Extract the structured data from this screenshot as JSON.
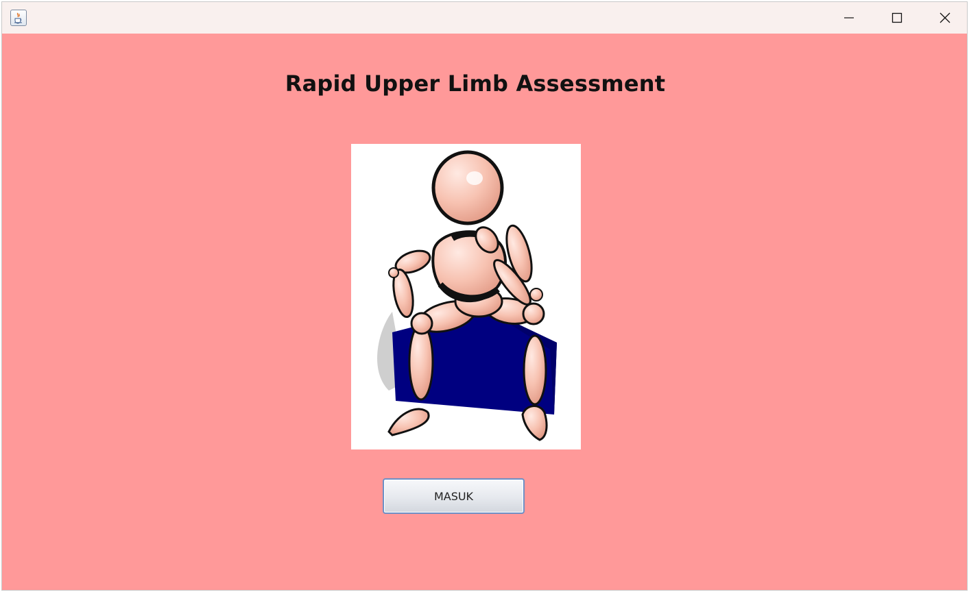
{
  "window": {
    "title": "",
    "icon": "java-cup-icon",
    "controls": [
      "minimize-icon",
      "maximize-icon",
      "close-icon"
    ]
  },
  "main": {
    "heading": "Rapid Upper Limb Assessment",
    "illustration": "seated-mannequin-illustration",
    "enter_button_label": "MASUK"
  },
  "colors": {
    "background": "#ff9999",
    "titlebar": "#f9f0ee",
    "box": "#000080",
    "skin": "#f9c7b8"
  }
}
